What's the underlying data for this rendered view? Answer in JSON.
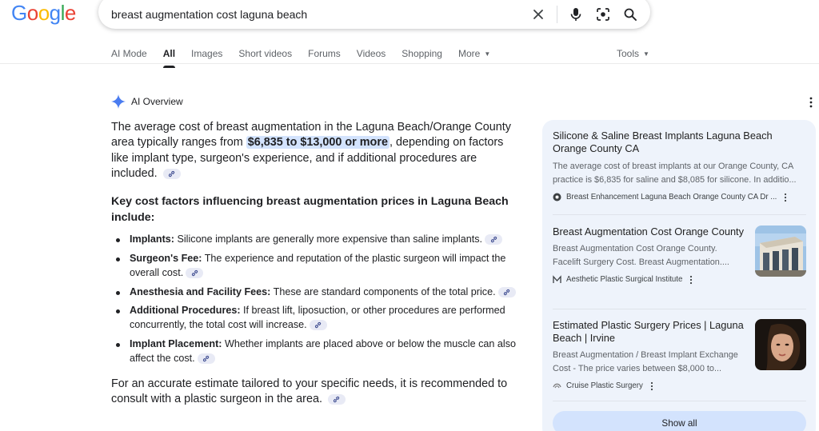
{
  "logo": {
    "text": "Google"
  },
  "search": {
    "query": "breast augmentation cost laguna beach"
  },
  "tabs": [
    {
      "label": "AI Mode"
    },
    {
      "label": "All"
    },
    {
      "label": "Images"
    },
    {
      "label": "Short videos"
    },
    {
      "label": "Forums"
    },
    {
      "label": "Videos"
    },
    {
      "label": "Shopping"
    },
    {
      "label": "More"
    }
  ],
  "tools_label": "Tools",
  "ai_overview": {
    "label": "AI Overview",
    "intro_before": "The average cost of breast augmentation in the Laguna Beach/Orange County area typically ranges from ",
    "intro_highlight": "$6,835 to $13,000 or more",
    "intro_after": ", depending on factors like implant type, surgeon's experience, and if additional procedures are included.",
    "heading": "Key cost factors influencing breast augmentation prices in Laguna Beach include:",
    "bullets": [
      {
        "term": "Implants:",
        "text": " Silicone implants are generally more expensive than saline implants."
      },
      {
        "term": "Surgeon's Fee:",
        "text": " The experience and reputation of the plastic surgeon will impact the overall cost."
      },
      {
        "term": "Anesthesia and Facility Fees:",
        "text": " These are standard components of the total price."
      },
      {
        "term": "Additional Procedures:",
        "text": " If breast lift, liposuction, or other procedures are performed concurrently, the total cost will increase."
      },
      {
        "term": "Implant Placement:",
        "text": " Whether implants are placed above or below the muscle can also affect the cost."
      }
    ],
    "closing": "For an accurate estimate tailored to your specific needs, it is recommended to consult with a plastic surgeon in the area."
  },
  "sources": [
    {
      "title": "Silicone & Saline Breast Implants Laguna Beach Orange County CA",
      "snippet1": "The average cost of breast implants at our Orange County, CA",
      "snippet2": "practice is $6,835 for saline and $8,085 for silicone. In additio...",
      "source": "Breast Enhancement Laguna Beach Orange County CA Dr ..."
    },
    {
      "title": "Breast Augmentation Cost Orange County",
      "snippet1": "Breast Augmentation Cost Orange County.",
      "snippet2": "Facelift Surgery Cost. Breast Augmentation....",
      "source": "Aesthetic Plastic Surgical Institute"
    },
    {
      "title": "Estimated Plastic Surgery Prices | Laguna Beach | Irvine",
      "snippet1": "Breast Augmentation / Breast Implant Exchange",
      "snippet2": "Cost - The price varies between $8,000 to...",
      "source": "Cruise Plastic Surgery"
    }
  ],
  "show_all_label": "Show all"
}
